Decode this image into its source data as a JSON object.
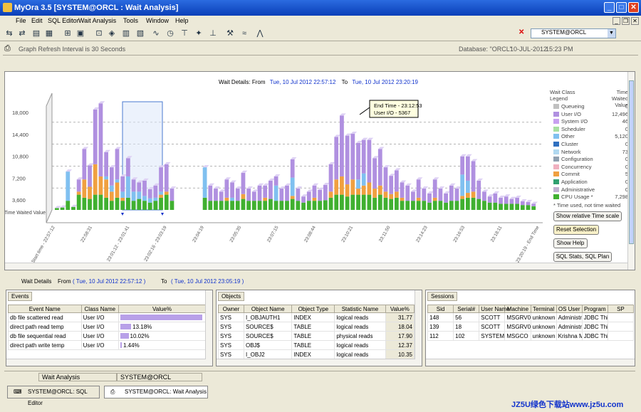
{
  "window": {
    "title": "MyOra 3.5  [SYSTEM@ORCL : Wait Analysis]"
  },
  "menu": [
    "File",
    "Edit",
    "SQL Editor",
    "Wait Analysis",
    "Tools",
    "Window",
    "Help"
  ],
  "connection": {
    "value": "SYSTEM@ORCL"
  },
  "infobar": {
    "refresh": "Graph Refresh Interval is 30 Seconds",
    "database": "Database: \"ORCL\"",
    "date": "10-JUL-2012",
    "time": "15:23 PM"
  },
  "chart_data": {
    "type": "bar",
    "title_prefix": "Wait Details: From",
    "from": "Tue, 10 Jul 2012 22:57:12",
    "to_label": "To",
    "to": "Tue, 10 Jul 2012 23:20:19",
    "y_label": "Time Waited Value",
    "y_ticks": [
      "18,000",
      "14,400",
      "10,800",
      "7,200",
      "3,600"
    ],
    "x_ticks": [
      "Start time - 22:57:12",
      "22:58:31",
      "23:01:12 - 23:01:41",
      "23:02:16 - 23:03:19",
      "23:04:19",
      "23:05:35",
      "23:07:15",
      "23:08:44",
      "23:10:21",
      "23:11:50",
      "23:14:23",
      "23:16:53",
      "23:18:11",
      "23:20:19 - End Time"
    ],
    "series": [
      {
        "name": "Queueing",
        "color": "#c0c0c0"
      },
      {
        "name": "User I/O",
        "color": "#b090e0"
      },
      {
        "name": "System I/O",
        "color": "#c8a0f0"
      },
      {
        "name": "Scheduler",
        "color": "#a8e0a0"
      },
      {
        "name": "Other",
        "color": "#80c0f0"
      },
      {
        "name": "Cluster",
        "color": "#3070c0"
      },
      {
        "name": "Network",
        "color": "#b0d8f0"
      },
      {
        "name": "Configuration",
        "color": "#90a0b0"
      },
      {
        "name": "Concurrency",
        "color": "#f0b0c0"
      },
      {
        "name": "Commit",
        "color": "#f0a040"
      },
      {
        "name": "Application",
        "color": "#30a070"
      },
      {
        "name": "Administrative",
        "color": "#c0b0d0"
      },
      {
        "name": "CPU Usage *",
        "color": "#40b030"
      }
    ],
    "legend_header": [
      "Wait Class Legend",
      "Time Waited Value"
    ],
    "legend_values": [
      "0",
      "12,496",
      "46",
      "0",
      "5,120",
      "0",
      "73",
      "0",
      "0",
      "5",
      "0",
      "0",
      "7,298"
    ],
    "legend_note": "* Time used, not time waited",
    "tooltip": [
      "End Time - 23:12:53",
      "User I/O - 5367"
    ],
    "bars": [
      {
        "u": 0,
        "o": 0,
        "c": 300,
        "a": 0
      },
      {
        "u": 0,
        "o": 0,
        "c": 400,
        "a": 0
      },
      {
        "u": 0,
        "o": 4800,
        "c": 1500,
        "a": 0
      },
      {
        "u": 0,
        "o": 0,
        "c": 500,
        "a": 0
      },
      {
        "u": 2000,
        "o": 0,
        "c": 2500,
        "a": 500
      },
      {
        "u": 5000,
        "o": 0,
        "c": 2000,
        "a": 3000
      },
      {
        "u": 3500,
        "o": 0,
        "c": 1800,
        "a": 2000
      },
      {
        "u": 9000,
        "o": 0,
        "c": 2500,
        "a": 5000
      },
      {
        "u": 12000,
        "o": 0,
        "c": 2500,
        "a": 3000
      },
      {
        "u": 4000,
        "o": 500,
        "c": 2000,
        "a": 3000
      },
      {
        "u": 3000,
        "o": 1000,
        "c": 1500,
        "a": 1500
      },
      {
        "u": 5000,
        "o": 500,
        "c": 2000,
        "a": 2500
      },
      {
        "u": 2500,
        "o": 1000,
        "c": 1500,
        "a": 500
      },
      {
        "u": 3000,
        "o": 3500,
        "c": 2000,
        "a": 0
      },
      {
        "u": 2000,
        "o": 1500,
        "c": 1500,
        "a": 0
      },
      {
        "u": 1500,
        "o": 1200,
        "c": 1800,
        "a": 0
      },
      {
        "u": 2500,
        "o": 800,
        "c": 1500,
        "a": 0
      },
      {
        "u": 1500,
        "o": 700,
        "c": 1200,
        "a": 0
      },
      {
        "u": 2000,
        "o": 500,
        "c": 1500,
        "a": 0
      },
      {
        "u": 4000,
        "o": 500,
        "c": 2000,
        "a": 500
      },
      {
        "u": 4500,
        "o": 0,
        "c": 2500,
        "a": 500
      },
      {
        "u": 2000,
        "o": 0,
        "c": 1500,
        "a": 0
      },
      {
        "u": 0,
        "o": 0,
        "c": 0,
        "a": 0
      },
      {
        "u": 0,
        "o": 0,
        "c": 0,
        "a": 0
      },
      {
        "u": 0,
        "o": 0,
        "c": 0,
        "a": 0
      },
      {
        "u": 0,
        "o": 0,
        "c": 0,
        "a": 0
      },
      {
        "u": 0,
        "o": 0,
        "c": 0,
        "a": 0
      },
      {
        "u": 0,
        "o": 5000,
        "c": 2000,
        "a": 0
      },
      {
        "u": 2500,
        "o": 0,
        "c": 1500,
        "a": 0
      },
      {
        "u": 2000,
        "o": 0,
        "c": 1500,
        "a": 0
      },
      {
        "u": 1500,
        "o": 0,
        "c": 1500,
        "a": 0
      },
      {
        "u": 3000,
        "o": 0,
        "c": 1500,
        "a": 500
      },
      {
        "u": 2500,
        "o": 500,
        "c": 1500,
        "a": 0
      },
      {
        "u": 2000,
        "o": 0,
        "c": 1500,
        "a": 0
      },
      {
        "u": 3500,
        "o": 0,
        "c": 1800,
        "a": 800
      },
      {
        "u": 2000,
        "o": 0,
        "c": 1500,
        "a": 0
      },
      {
        "u": 1500,
        "o": 0,
        "c": 1500,
        "a": 0
      },
      {
        "u": 2500,
        "o": 0,
        "c": 1500,
        "a": 0
      },
      {
        "u": 2000,
        "o": 0,
        "c": 1500,
        "a": 500
      },
      {
        "u": 3000,
        "o": 0,
        "c": 1800,
        "a": 0
      },
      {
        "u": 1500,
        "o": 2500,
        "c": 1500,
        "a": 0
      },
      {
        "u": 2000,
        "o": 0,
        "c": 1500,
        "a": 0
      },
      {
        "u": 2500,
        "o": 0,
        "c": 1500,
        "a": 0
      },
      {
        "u": 3000,
        "o": 3000,
        "c": 1800,
        "a": 500
      },
      {
        "u": 2000,
        "o": 0,
        "c": 1500,
        "a": 0
      },
      {
        "u": 1000,
        "o": 0,
        "c": 1200,
        "a": 0
      },
      {
        "u": 1500,
        "o": 0,
        "c": 1500,
        "a": 0
      },
      {
        "u": 2000,
        "o": 0,
        "c": 1500,
        "a": 500
      },
      {
        "u": 1800,
        "o": 0,
        "c": 1500,
        "a": 0
      },
      {
        "u": 2500,
        "o": 0,
        "c": 1600,
        "a": 0
      },
      {
        "u": 4500,
        "o": 0,
        "c": 2000,
        "a": 1000
      },
      {
        "u": 7000,
        "o": 0,
        "c": 2500,
        "a": 2500
      },
      {
        "u": 10000,
        "o": 0,
        "c": 2500,
        "a": 3000
      },
      {
        "u": 8000,
        "o": 0,
        "c": 2200,
        "a": 2000
      },
      {
        "u": 7500,
        "o": 0,
        "c": 2500,
        "a": 2500
      },
      {
        "u": 6000,
        "o": 1500,
        "c": 2500,
        "a": 1000
      },
      {
        "u": 5500,
        "o": 2000,
        "c": 2500,
        "a": 1500
      },
      {
        "u": 7000,
        "o": 0,
        "c": 2500,
        "a": 2000
      },
      {
        "u": 5000,
        "o": 0,
        "c": 2000,
        "a": 1500
      },
      {
        "u": 6000,
        "o": 0,
        "c": 2500,
        "a": 1500
      },
      {
        "u": 4000,
        "o": 0,
        "c": 2000,
        "a": 1000
      },
      {
        "u": 3000,
        "o": 0,
        "c": 1800,
        "a": 800
      },
      {
        "u": 3500,
        "o": 0,
        "c": 2000,
        "a": 1000
      },
      {
        "u": 2500,
        "o": 0,
        "c": 1500,
        "a": 500
      },
      {
        "u": 2500,
        "o": 0,
        "c": 1500,
        "a": 0
      },
      {
        "u": 1500,
        "o": 0,
        "c": 1500,
        "a": 0
      },
      {
        "u": 3000,
        "o": 0,
        "c": 1500,
        "a": 500
      },
      {
        "u": 2000,
        "o": 0,
        "c": 1500,
        "a": 0
      },
      {
        "u": 1500,
        "o": 0,
        "c": 1200,
        "a": 0
      },
      {
        "u": 3000,
        "o": 0,
        "c": 1500,
        "a": 500
      },
      {
        "u": 2000,
        "o": 0,
        "c": 1500,
        "a": 0
      },
      {
        "u": 1500,
        "o": 0,
        "c": 1200,
        "a": 0
      },
      {
        "u": 2500,
        "o": 0,
        "c": 1500,
        "a": 0
      },
      {
        "u": 2000,
        "o": 0,
        "c": 1500,
        "a": 0
      },
      {
        "u": 3000,
        "o": 3500,
        "c": 1800,
        "a": 500
      },
      {
        "u": 4000,
        "o": 2000,
        "c": 2000,
        "a": 800
      },
      {
        "u": 5000,
        "o": 0,
        "c": 2000,
        "a": 1000
      },
      {
        "u": 3000,
        "o": 0,
        "c": 1800,
        "a": 0
      },
      {
        "u": 1500,
        "o": 0,
        "c": 1500,
        "a": 0
      },
      {
        "u": 1000,
        "o": 0,
        "c": 1200,
        "a": 0
      },
      {
        "u": 1500,
        "o": 0,
        "c": 1200,
        "a": 0
      },
      {
        "u": 1000,
        "o": 0,
        "c": 1000,
        "a": 0
      },
      {
        "u": 1200,
        "o": 0,
        "c": 1000,
        "a": 0
      },
      {
        "u": 800,
        "o": 0,
        "c": 1000,
        "a": 0
      },
      {
        "u": 1000,
        "o": 0,
        "c": 1000,
        "a": 0
      },
      {
        "u": 600,
        "o": 0,
        "c": 800,
        "a": 0
      },
      {
        "u": 500,
        "o": 0,
        "c": 800,
        "a": 0
      },
      {
        "u": 400,
        "o": 0,
        "c": 600,
        "a": 0
      }
    ]
  },
  "legend_buttons": [
    "Show relative Time scale",
    "Reset Selection",
    "Show Help",
    "SQL Stats, SQL Plan"
  ],
  "detail": {
    "label": "Wait Details",
    "from_label": "From",
    "from": "( Tue, 10 Jul 2012 22:57:12 )",
    "to_label": "To",
    "to": "( Tue, 10 Jul 2012 23:05:19 )"
  },
  "events": {
    "tab": "Events",
    "columns": [
      "Event Name",
      "Class Name",
      "Value%"
    ],
    "rows": [
      {
        "event": "db file scattered read",
        "class": "User I/O",
        "pct": 100,
        "pct_label": ""
      },
      {
        "event": "direct path read temp",
        "class": "User I/O",
        "pct": 13.18,
        "pct_label": "13.18%"
      },
      {
        "event": "db file sequential read",
        "class": "User I/O",
        "pct": 10.02,
        "pct_label": "10.02%"
      },
      {
        "event": "direct path write temp",
        "class": "User I/O",
        "pct": 1.44,
        "pct_label": "1.44%"
      }
    ]
  },
  "objects": {
    "tab": "Objects",
    "columns": [
      "Owner",
      "Object Name",
      "Object Type",
      "Statistic Name",
      "Value%"
    ],
    "rows": [
      [
        "SYS",
        "I_OBJAUTH1",
        "INDEX",
        "logical reads",
        "31.77"
      ],
      [
        "SYS",
        "SOURCE$",
        "TABLE",
        "logical reads",
        "18.04"
      ],
      [
        "SYS",
        "SOURCE$",
        "TABLE",
        "physical reads",
        "17.90"
      ],
      [
        "SYS",
        "OBJ$",
        "TABLE",
        "logical reads",
        "12.37"
      ],
      [
        "SYS",
        "I_OBJ2",
        "INDEX",
        "logical reads",
        "10.35"
      ]
    ]
  },
  "sessions": {
    "tab": "Sessions",
    "columns": [
      "Sid",
      "Serial#",
      "User Name",
      "Machine",
      "Terminal",
      "OS User",
      "Program",
      "SP"
    ],
    "rows": [
      [
        "148",
        "56",
        "SCOTT",
        "MSGRV0",
        "unknown",
        "Administrator",
        "JDBC Thin Client",
        ""
      ],
      [
        "139",
        "18",
        "SCOTT",
        "MSGRV0",
        "unknown",
        "Administrator",
        "JDBC Thin Client",
        ""
      ],
      [
        "112",
        "102",
        "SYSTEM",
        "MSGCO",
        "unknown",
        "Krishna Murthy",
        "JDBC Thin Client",
        ""
      ]
    ]
  },
  "statusbar": {
    "panel1": "Wait Analysis",
    "panel2": "SYSTEM@ORCL"
  },
  "taskbar": {
    "tab1": "SYSTEM@ORCL: SQL Editor",
    "tab2": "SYSTEM@ORCL: Wait Analysis"
  },
  "watermark": "JZ5U绿色下载站www.jz5u.com"
}
